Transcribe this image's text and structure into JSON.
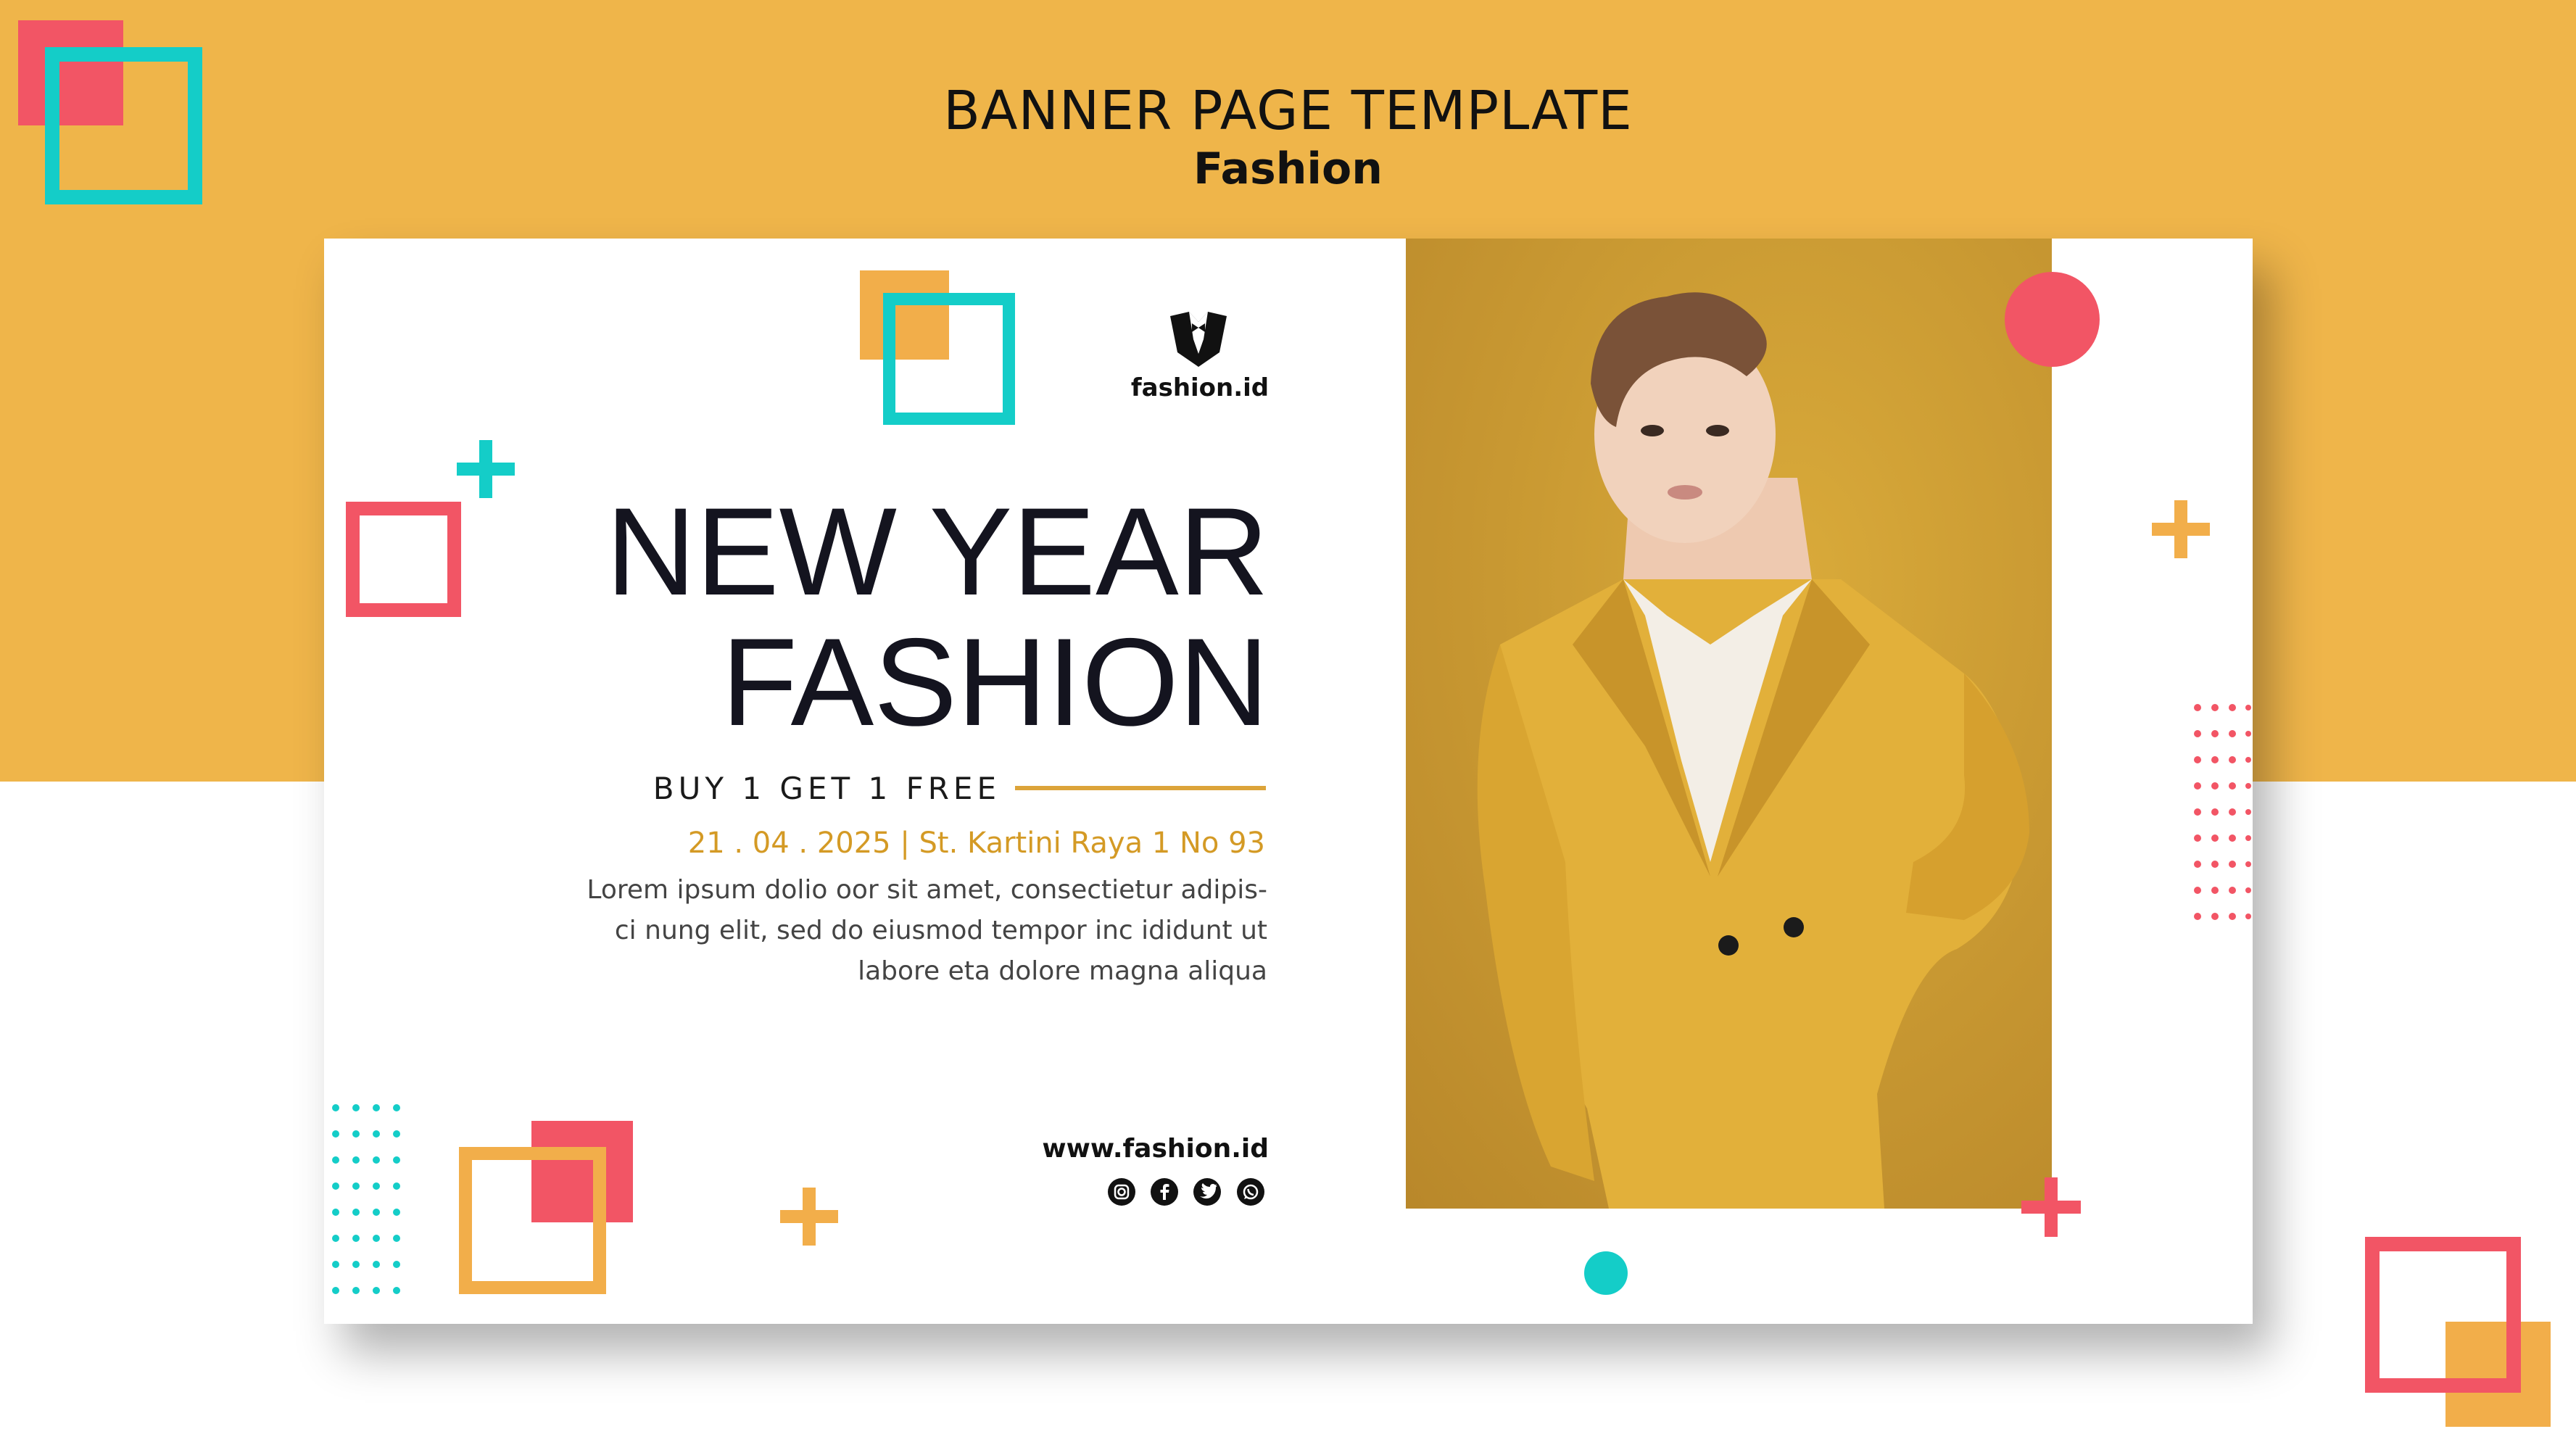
{
  "header": {
    "title": "BANNER PAGE TEMPLATE",
    "subtitle": "Fashion"
  },
  "brand": {
    "name": "fashion.id",
    "logo_icon": "tuxedo-icon"
  },
  "headline": {
    "line1": "NEW YEAR",
    "line2": "FASHION"
  },
  "offer": "BUY 1 GET 1 FREE",
  "event_details": "21  . 04 . 2025 | St. Kartini Raya 1 No 93",
  "description": {
    "line1": "Lorem ipsum dolio oor sit amet, consectietur adipis-",
    "line2": "ci nung elit, sed do eiusmod tempor inc ididunt ut",
    "line3": "labore eta dolore magna aliqua"
  },
  "website": "www.fashion.id",
  "social_icons": [
    "instagram-icon",
    "facebook-icon",
    "twitter-icon",
    "whatsapp-icon"
  ],
  "colors": {
    "background_band": "#efb54a",
    "accent_teal": "#14cdc8",
    "accent_red": "#f25565",
    "accent_orange": "#f2ae4a",
    "text_dark": "#14141f",
    "date_gold": "#d49a25",
    "photo_background": "#c99a2c"
  }
}
